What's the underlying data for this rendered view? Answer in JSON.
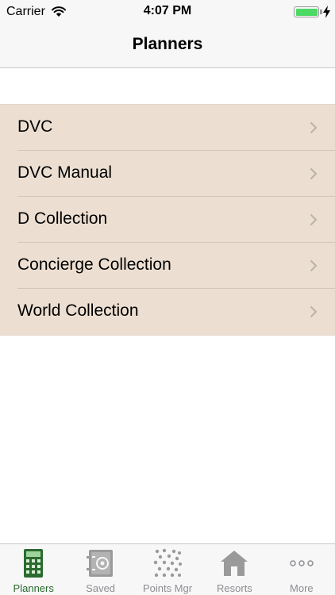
{
  "status": {
    "carrier": "Carrier",
    "time": "4:07 PM"
  },
  "nav": {
    "title": "Planners"
  },
  "list": {
    "items": [
      {
        "label": "DVC"
      },
      {
        "label": "DVC Manual"
      },
      {
        "label": "D Collection"
      },
      {
        "label": "Concierge Collection"
      },
      {
        "label": "World Collection"
      }
    ]
  },
  "tabs": [
    {
      "label": "Planners",
      "icon": "calculator-icon",
      "active": true
    },
    {
      "label": "Saved",
      "icon": "safe-icon",
      "active": false
    },
    {
      "label": "Points Mgr",
      "icon": "dots-grid-icon",
      "active": false
    },
    {
      "label": "Resorts",
      "icon": "house-icon",
      "active": false
    },
    {
      "label": "More",
      "icon": "more-icon",
      "active": false
    }
  ],
  "colors": {
    "list_bg": "#ecdfd2",
    "active_tab": "#2a6b2f",
    "inactive_tab": "#8e8e93",
    "battery": "#4cd964"
  }
}
